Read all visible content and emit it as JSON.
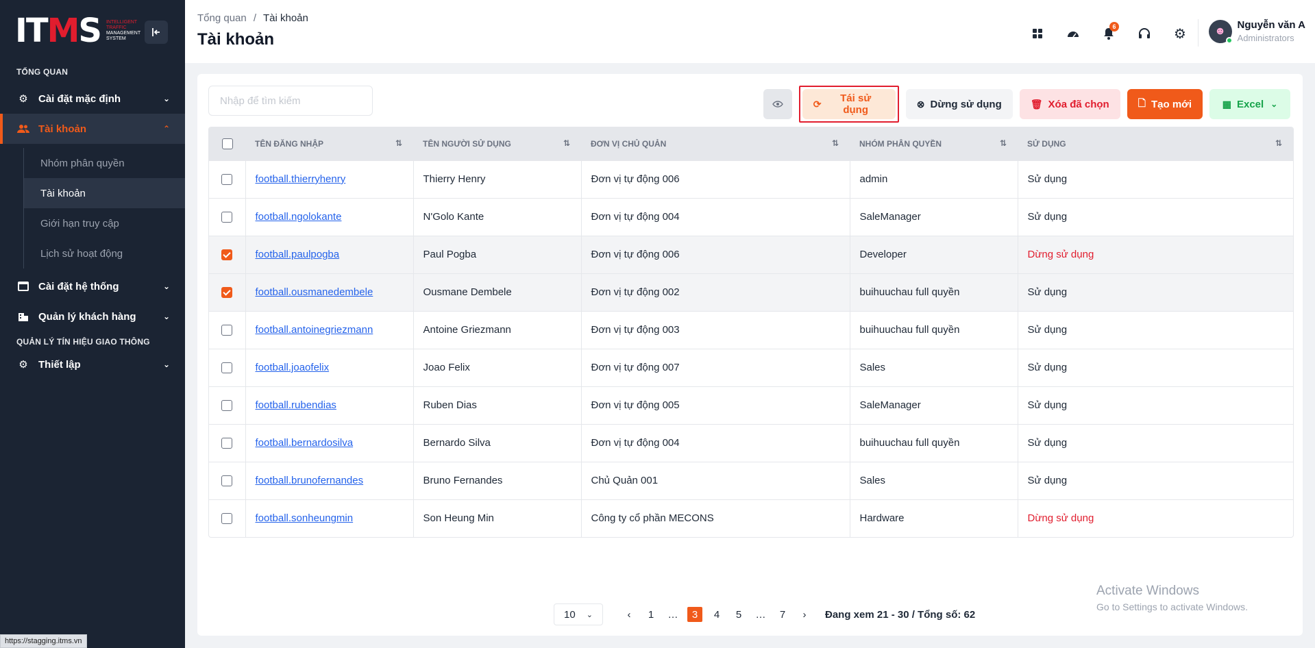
{
  "logo": {
    "brand_main": "IT",
    "brand_accent": "M",
    "brand_end": "S",
    "sub1": "INTELLIGENT",
    "sub2": "TRAFFIC",
    "sub3": "MANAGEMENT",
    "sub4": "SYSTEM"
  },
  "sidebar": {
    "section_overview": "TỔNG QUAN",
    "items": [
      {
        "label": "Cài đặt mặc định",
        "icon": "gear-icon"
      },
      {
        "label": "Tài khoản",
        "icon": "users-icon"
      }
    ],
    "submenu": [
      {
        "label": "Nhóm phân quyền"
      },
      {
        "label": "Tài khoản"
      },
      {
        "label": "Giới hạn truy cập"
      },
      {
        "label": "Lịch sử hoạt động"
      }
    ],
    "items2": [
      {
        "label": "Cài đặt hệ thống",
        "icon": "window-icon"
      },
      {
        "label": "Quản lý khách hàng",
        "icon": "building-icon"
      }
    ],
    "section_traffic": "QUẢN LÝ TÍN HIỆU GIAO THÔNG",
    "items3": [
      {
        "label": "Thiết lập",
        "icon": "gear-icon"
      }
    ]
  },
  "status_url": "https://stagging.itms.vn",
  "header": {
    "breadcrumb_root": "Tổng quan",
    "breadcrumb_sep": "/",
    "breadcrumb_current": "Tài khoản",
    "title": "Tài khoản",
    "notification_count": "6",
    "user_name": "Nguyễn văn A",
    "user_role": "Administrators"
  },
  "toolbar": {
    "search_placeholder": "Nhập để tìm kiếm",
    "reuse": "Tái sử dụng",
    "stop": "Dừng sử dụng",
    "delete": "Xóa đã chọn",
    "create": "Tạo mới",
    "excel": "Excel"
  },
  "table": {
    "headers": [
      "TÊN ĐĂNG NHẬP",
      "TÊN NGƯỜI SỬ DỤNG",
      "ĐƠN VỊ CHỦ QUẢN",
      "NHÓM PHÂN QUYỀN",
      "SỬ DỤNG"
    ],
    "rows": [
      {
        "username": "football.thierryhenry",
        "name": "Thierry Henry",
        "unit": "Đơn vị tự động 006",
        "group": "admin",
        "status": "Sử dụng"
      },
      {
        "username": "football.ngolokante",
        "name": "N'Golo Kante",
        "unit": "Đơn vị tự động 004",
        "group": "SaleManager",
        "status": "Sử dụng"
      },
      {
        "username": "football.paulpogba",
        "name": "Paul Pogba",
        "unit": "Đơn vị tự động 006",
        "group": "Developer",
        "status": "Dừng sử dụng"
      },
      {
        "username": "football.ousmanedembele",
        "name": "Ousmane Dembele",
        "unit": "Đơn vị tự động 002",
        "group": "buihuuchau full quyền",
        "status": "Sử dụng"
      },
      {
        "username": "football.antoinegriezmann",
        "name": "Antoine Griezmann",
        "unit": "Đơn vị tự động 003",
        "group": "buihuuchau full quyền",
        "status": "Sử dụng"
      },
      {
        "username": "football.joaofelix",
        "name": "Joao Felix",
        "unit": "Đơn vị tự động 007",
        "group": "Sales",
        "status": "Sử dụng"
      },
      {
        "username": "football.rubendias",
        "name": "Ruben Dias",
        "unit": "Đơn vị tự động 005",
        "group": "SaleManager",
        "status": "Sử dụng"
      },
      {
        "username": "football.bernardosilva",
        "name": "Bernardo Silva",
        "unit": "Đơn vị tự động 004",
        "group": "buihuuchau full quyền",
        "status": "Sử dụng"
      },
      {
        "username": "football.brunofernandes",
        "name": "Bruno Fernandes",
        "unit": "Chủ Quản 001",
        "group": "Sales",
        "status": "Sử dụng"
      },
      {
        "username": "football.sonheungmin",
        "name": "Son Heung Min",
        "unit": "Công ty cổ phần MECONS",
        "group": "Hardware",
        "status": "Dừng sử dụng"
      }
    ]
  },
  "pagination": {
    "page_size": "10",
    "pages": [
      "1",
      "…",
      "3",
      "4",
      "5",
      "…",
      "7"
    ],
    "current": "3",
    "info": "Đang xem 21 - 30 / Tổng số: 62"
  },
  "watermark": {
    "line1": "Activate Windows",
    "line2": "Go to Settings to activate Windows."
  },
  "colors": {
    "accent": "#f05a1a",
    "sidebar_bg": "#1b2433",
    "danger": "#e11d2e",
    "link": "#2563eb"
  }
}
